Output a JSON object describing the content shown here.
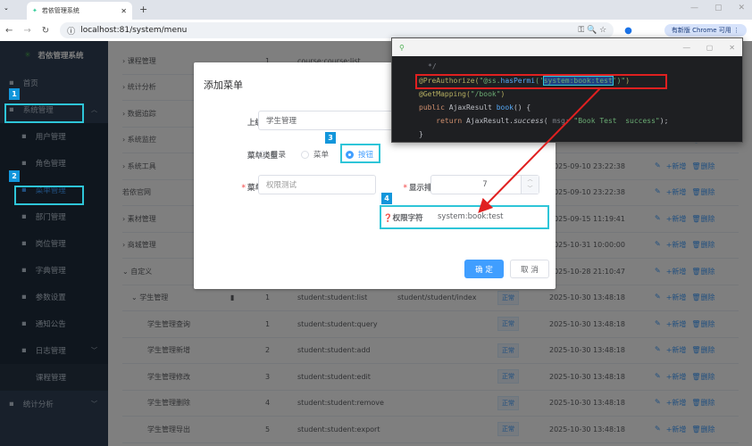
{
  "browser": {
    "tab_title": "若依管理系统",
    "url": "localhost:81/system/menu",
    "update_label": "有新版 Chrome 可用"
  },
  "sidebar": {
    "logo": "若依管理系统",
    "items": [
      {
        "label": "首页",
        "icon": "dashboard-icon"
      },
      {
        "label": "系统管理",
        "icon": "gear-icon"
      },
      {
        "label": "用户管理",
        "icon": "user-icon"
      },
      {
        "label": "角色管理",
        "icon": "peoples-icon"
      },
      {
        "label": "菜单管理",
        "icon": "tree-table-icon"
      },
      {
        "label": "部门管理",
        "icon": "tree-icon"
      },
      {
        "label": "岗位管理",
        "icon": "post-icon"
      },
      {
        "label": "字典管理",
        "icon": "dict-icon"
      },
      {
        "label": "参数设置",
        "icon": "edit-icon"
      },
      {
        "label": "通知公告",
        "icon": "message-icon"
      },
      {
        "label": "日志管理",
        "icon": "log-icon"
      },
      {
        "label": "课程管理",
        "icon": ""
      },
      {
        "label": "统计分析",
        "icon": "chart-icon"
      }
    ]
  },
  "table": {
    "rows": [
      {
        "name": "课程管理",
        "order": "1",
        "perm": "course:course:list",
        "comp": "",
        "status": "",
        "time": "",
        "prefix": ">"
      },
      {
        "name": "统计分析",
        "order": "",
        "perm": "",
        "comp": "",
        "status": "",
        "time": "",
        "prefix": ">"
      },
      {
        "name": "数据追踪",
        "order": "",
        "perm": "",
        "comp": "",
        "status": "",
        "time": "",
        "prefix": ">"
      },
      {
        "name": "系统监控",
        "order": "",
        "perm": "",
        "comp": "",
        "status": "",
        "time": "",
        "prefix": ">"
      },
      {
        "name": "系统工具",
        "order": "",
        "perm": "",
        "comp": "",
        "status": "",
        "time": "2025-09-10 23:22:38",
        "prefix": ">"
      },
      {
        "name": "若依官网",
        "order": "",
        "perm": "",
        "comp": "",
        "status": "",
        "time": "2025-09-10 23:22:38",
        "prefix": ""
      },
      {
        "name": "素材管理",
        "order": "",
        "perm": "",
        "comp": "",
        "status": "",
        "time": "2025-09-15 11:19:41",
        "prefix": ">"
      },
      {
        "name": "商城管理",
        "order": "",
        "perm": "",
        "comp": "",
        "status": "",
        "time": "2025-10-31 10:00:00",
        "prefix": ">"
      },
      {
        "name": "自定义",
        "order": "",
        "perm": "",
        "comp": "",
        "status": "",
        "time": "2025-10-28 21:10:47",
        "prefix": "v"
      },
      {
        "name": "学生管理",
        "order": "1",
        "perm": "student:student:list",
        "comp": "student/student/index",
        "status": "正常",
        "time": "2025-10-30 13:48:18",
        "prefix": "v"
      },
      {
        "name": "学生管理查询",
        "order": "1",
        "perm": "student:student:query",
        "comp": "",
        "status": "正常",
        "time": "2025-10-30 13:48:18",
        "prefix": ""
      },
      {
        "name": "学生管理新增",
        "order": "2",
        "perm": "student:student:add",
        "comp": "",
        "status": "正常",
        "time": "2025-10-30 13:48:18",
        "prefix": ""
      },
      {
        "name": "学生管理修改",
        "order": "3",
        "perm": "student:student:edit",
        "comp": "",
        "status": "正常",
        "time": "2025-10-30 13:48:18",
        "prefix": ""
      },
      {
        "name": "学生管理删除",
        "order": "4",
        "perm": "student:student:remove",
        "comp": "",
        "status": "正常",
        "time": "2025-10-30 13:48:18",
        "prefix": ""
      },
      {
        "name": "学生管理导出",
        "order": "5",
        "perm": "student:student:export",
        "comp": "",
        "status": "正常",
        "time": "2025-10-30 13:48:18",
        "prefix": ""
      }
    ],
    "action_add": "+新增",
    "action_delete": "删除"
  },
  "dialog": {
    "title": "添加菜单",
    "parent_label": "上级菜单",
    "parent_value": "学生管理",
    "type_label": "菜单类型",
    "types": [
      "目录",
      "菜单",
      "按钮"
    ],
    "name_label": "菜单名称",
    "name_value": "权限测试",
    "order_label": "显示排序",
    "order_value": "7",
    "perm_label": "权限字符",
    "perm_value": "system:book:test",
    "confirm": "确 定",
    "cancel": "取 消"
  },
  "badges": [
    "1",
    "2",
    "3",
    "4"
  ],
  "code": {
    "lines": [
      "*/",
      "@PreAuthorize(\"@ss.hasPermi('system:book:test')\")",
      "@GetMapping(\"/book\")",
      "public AjaxResult book() {",
      "    return AjaxResult.success( msg: \"Book Test  success\");",
      "}"
    ]
  },
  "colors": {
    "primary": "#409eff",
    "highlight": "#2ec5d8",
    "annotation_red": "#e02020"
  }
}
